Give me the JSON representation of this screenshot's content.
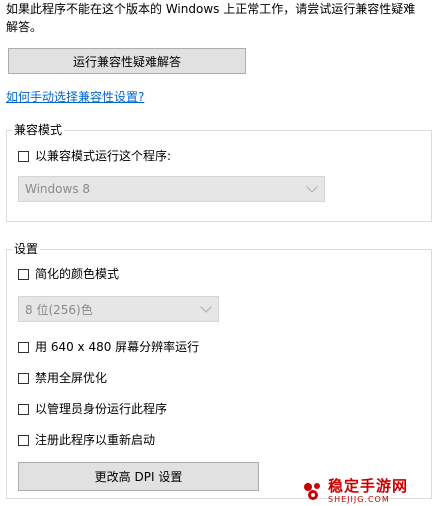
{
  "intro_text": "如果此程序不能在这个版本的 Windows 上正常工作，请尝试运行兼容性疑难解答。",
  "troubleshoot_button_label": "运行兼容性疑难解答",
  "manual_link_label": "如何手动选择兼容性设置?",
  "compat_group": {
    "title": "兼容模式",
    "checkbox_label": "以兼容模式运行这个程序:",
    "checked": false,
    "os_select_value": "Windows 8"
  },
  "settings_group": {
    "title": "设置",
    "reduced_color_label": "简化的颜色模式",
    "reduced_color_checked": false,
    "color_select_value": "8 位(256)色",
    "res_640_label": "用 640 x 480 屏幕分辨率运行",
    "res_640_checked": false,
    "disable_fullscreen_label": "禁用全屏优化",
    "disable_fullscreen_checked": false,
    "run_as_admin_label": "以管理员身份运行此程序",
    "run_as_admin_checked": false,
    "register_restart_label": "注册此程序以重新启动",
    "register_restart_checked": false,
    "dpi_button_label": "更改高 DPI 设置"
  },
  "watermark": {
    "title": "稳定手游网",
    "url": "SHEJIJG.COM",
    "color": "#cc0000",
    "icon": "brand-logo-icon"
  },
  "colors": {
    "link": "#0066cc",
    "button_bg": "#e1e1e1",
    "select_bg": "#e6e6e6"
  }
}
